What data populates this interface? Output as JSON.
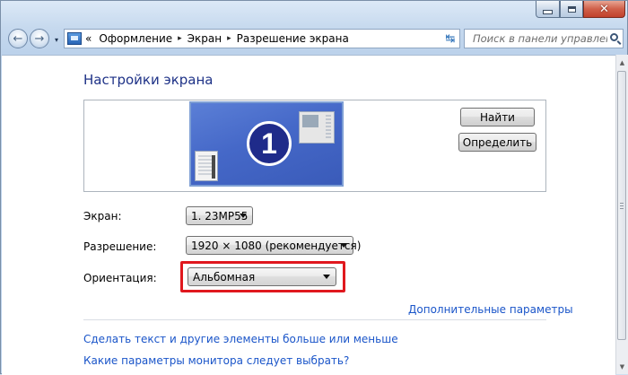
{
  "window": {
    "caption": {
      "minimize_glyph": "—",
      "maximize_glyph": "□",
      "close_glyph": "✕"
    }
  },
  "nav": {
    "back_glyph": "←",
    "forward_glyph": "→",
    "history_glyph": "▾",
    "breadcrumb_lead": "«",
    "breadcrumbs": [
      "Оформление",
      "Экран",
      "Разрешение экрана"
    ],
    "crumb_separator": "▸",
    "address_dropdown_glyph": "▾",
    "refresh_glyph": "↹",
    "search_placeholder": "Поиск в панели управления"
  },
  "main": {
    "title": "Настройки экрана",
    "monitor_number": "1",
    "find_button": "Найти",
    "identify_button": "Определить",
    "fields": {
      "screen_label": "Экран:",
      "screen_value": "1. 23MP55",
      "resolution_label": "Разрешение:",
      "resolution_value": "1920 × 1080 (рекомендуется)",
      "orientation_label": "Ориентация:",
      "orientation_value": "Альбомная"
    },
    "advanced_link": "Дополнительные параметры",
    "text_size_link": "Сделать текст и другие элементы больше или меньше",
    "monitor_params_link": "Какие параметры монитора следует выбрать?"
  },
  "scrollbar": {
    "up_glyph": "▲",
    "down_glyph": "▼"
  },
  "colors": {
    "title_blue": "#1e3287",
    "link_blue": "#1a55c9",
    "highlight_red": "#e0181e",
    "monitor_blue": "#4568c8"
  }
}
